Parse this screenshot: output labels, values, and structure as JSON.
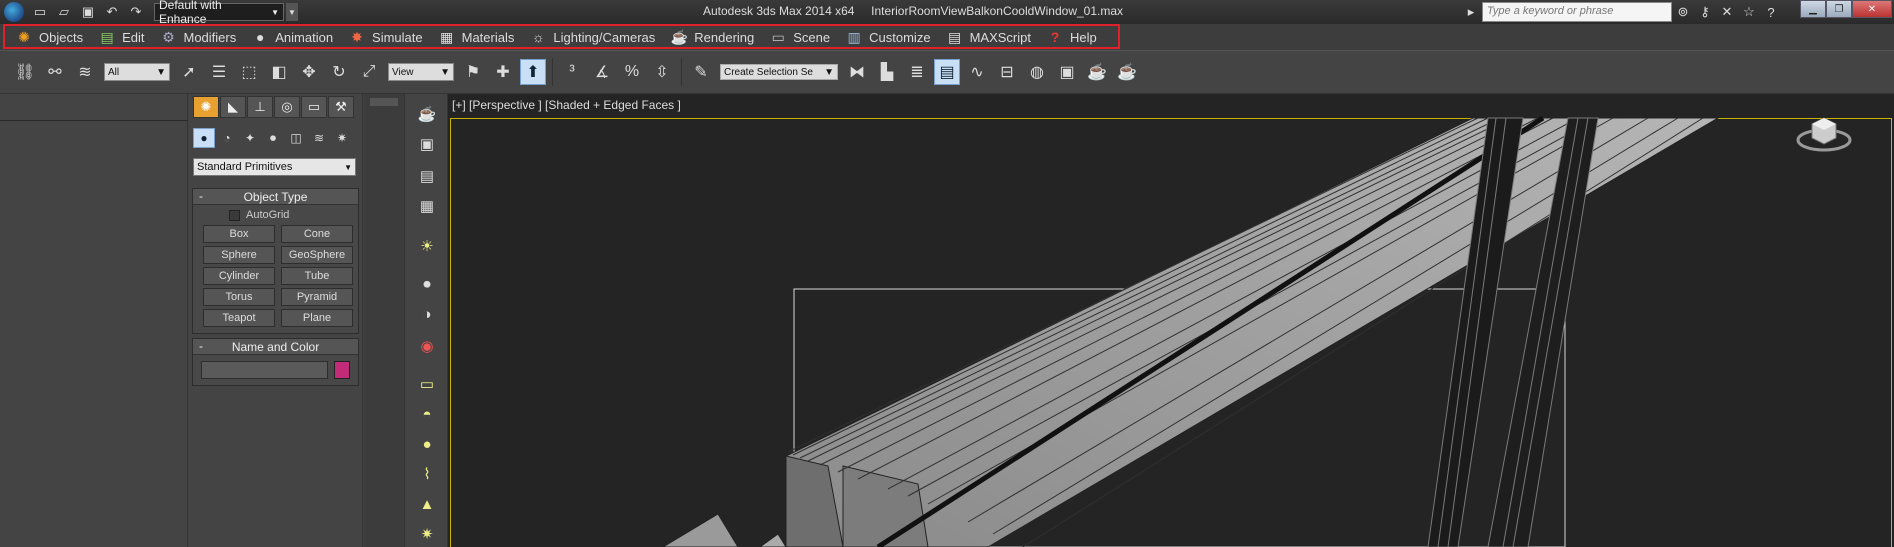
{
  "titlebar": {
    "workspace": "Default with Enhance",
    "app_title": "Autodesk 3ds Max  2014 x64",
    "file_name": "InteriorRoomViewBalkonCooldWindow_01.max",
    "search_placeholder": "Type a keyword or phrase",
    "quick_access_icons": [
      "new-icon",
      "open-icon",
      "save-icon",
      "undo-icon",
      "redo-icon"
    ],
    "right_icons": [
      "binoculars-icon",
      "key-icon",
      "tools-icon",
      "star-icon",
      "help-icon"
    ]
  },
  "menubar": {
    "items": [
      {
        "label": "Objects",
        "icon": "objects-icon"
      },
      {
        "label": "Edit",
        "icon": "edit-icon"
      },
      {
        "label": "Modifiers",
        "icon": "modifiers-icon"
      },
      {
        "label": "Animation",
        "icon": "animation-icon"
      },
      {
        "label": "Simulate",
        "icon": "simulate-icon"
      },
      {
        "label": "Materials",
        "icon": "materials-icon"
      },
      {
        "label": "Lighting/Cameras",
        "icon": "lighting-icon"
      },
      {
        "label": "Rendering",
        "icon": "rendering-icon"
      },
      {
        "label": "Scene",
        "icon": "scene-icon"
      },
      {
        "label": "Customize",
        "icon": "customize-icon"
      },
      {
        "label": "MAXScript",
        "icon": "maxscript-icon"
      },
      {
        "label": "Help",
        "icon": "help-icon"
      }
    ],
    "highlight_color": "#e0202a"
  },
  "toolbar": {
    "selection_filter": "All",
    "reference_coord": "View",
    "selection_set_placeholder": "Create Selection Se"
  },
  "command_panel": {
    "category": "Standard Primitives",
    "object_type_title": "Object Type",
    "autogrid_label": "AutoGrid",
    "primitives": [
      "Box",
      "Cone",
      "Sphere",
      "GeoSphere",
      "Cylinder",
      "Tube",
      "Torus",
      "Pyramid",
      "Teapot",
      "Plane"
    ],
    "name_color_title": "Name and Color",
    "object_color": "#c12b78",
    "active_tab_color": "#e8a030"
  },
  "viewport": {
    "label": "[+] [Perspective ] [Shaded + Edged Faces ]",
    "border_color": "#c8b400"
  }
}
